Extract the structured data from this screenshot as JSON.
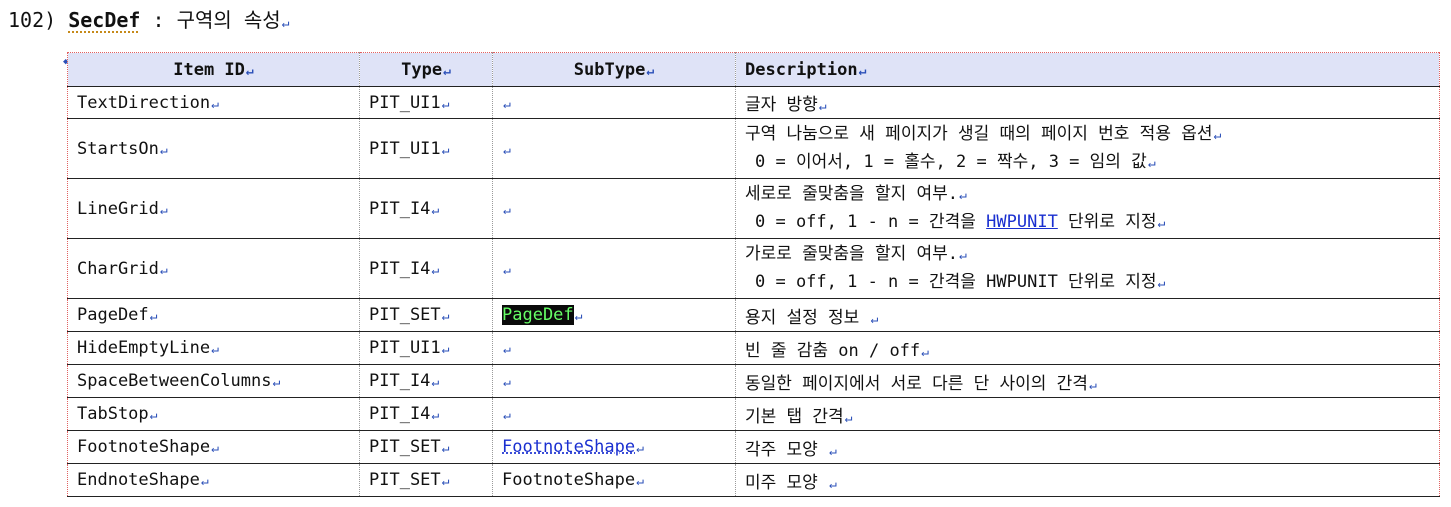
{
  "heading": {
    "number": "102)",
    "code": "SecDef",
    "separator": ":",
    "title": "구역의 속성"
  },
  "pilcrow": "↵",
  "table": {
    "headers": [
      "Item ID",
      "Type",
      "SubType",
      "Description"
    ],
    "rows": [
      {
        "id": "TextDirection",
        "type": "PIT_UI1",
        "subtype": "",
        "desc1": "글자 방향",
        "desc2": ""
      },
      {
        "id": "StartsOn",
        "type": "PIT_UI1",
        "subtype": "",
        "desc1": "구역 나눔으로 새 페이지가 생길 때의 페이지 번호 적용 옵션",
        "desc2": "0 = 이어서, 1 = 홀수, 2 = 짝수, 3 = 임의 값"
      },
      {
        "id": "LineGrid",
        "type": "PIT_I4",
        "subtype": "",
        "desc1": "세로로 줄맞춤을 할지 여부.",
        "desc2_pre": "0 = off, 1 - n = 간격을 ",
        "desc2_link": "HWPUNIT",
        "desc2_post": " 단위로 지정"
      },
      {
        "id": "CharGrid",
        "type": "PIT_I4",
        "subtype": "",
        "desc1": "가로로 줄맞춤을 할지 여부.",
        "desc2_pre": "0 = off, 1 - n = 간격을 ",
        "desc2_link": "HWPUNIT",
        "desc2_post": " 단위로 지정"
      },
      {
        "id": "PageDef",
        "type": "PIT_SET",
        "subtype": "PageDef",
        "desc1": "용지 설정 정보 ",
        "desc2": ""
      },
      {
        "id": "HideEmptyLine",
        "type": "PIT_UI1",
        "subtype": "",
        "desc1": "빈 줄 감춤 on / off",
        "desc2": ""
      },
      {
        "id": "SpaceBetweenColumns",
        "type": "PIT_I4",
        "subtype": "",
        "desc1": "동일한 페이지에서 서로 다른 단 사이의 간격",
        "desc2": ""
      },
      {
        "id": "TabStop",
        "type": "PIT_I4",
        "subtype": "",
        "desc1": "기본 탭 간격",
        "desc2": ""
      },
      {
        "id": "FootnoteShape",
        "type": "PIT_SET",
        "subtype": "FootnoteShape",
        "desc1": "각주 모양 ",
        "desc2": ""
      },
      {
        "id": "EndnoteShape",
        "type": "PIT_SET",
        "subtype": "FootnoteShape",
        "desc1": "미주 모양 ",
        "desc2": ""
      }
    ]
  }
}
